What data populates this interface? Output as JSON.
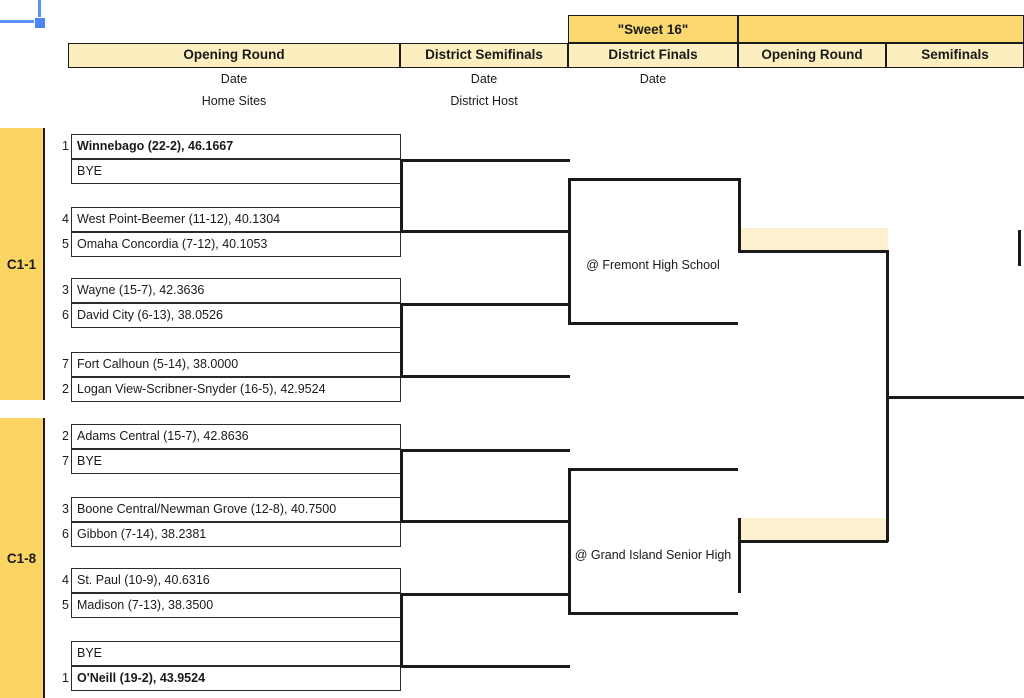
{
  "selection": {
    "name": "cell-selection-handle",
    "color": "#4a86f7"
  },
  "header": {
    "sweet16_label": "\"Sweet 16\"",
    "rounds": [
      {
        "label": "Opening Round",
        "date": "Date",
        "site": "Home Sites"
      },
      {
        "label": "District Semifinals",
        "date": "Date",
        "site": "District Host"
      },
      {
        "label": "District Finals",
        "date": "Date",
        "site": ""
      },
      {
        "label": "Opening Round",
        "date": "",
        "site": ""
      },
      {
        "label": "Semifinals",
        "date": "",
        "site": ""
      }
    ]
  },
  "colors": {
    "header_light_gold": "#fdeec0",
    "header_dark_gold": "#fbd970",
    "district_gold": "#fbd464",
    "slot_cream": "#fdf0cf",
    "line": "#1a1a1a"
  },
  "districts": [
    {
      "label": "C1-1",
      "venue": "@ Fremont High School",
      "matchups": [
        {
          "teams": [
            {
              "seed": "1",
              "name": "Winnebago (22-2), 46.1667",
              "bold": true
            },
            {
              "seed": "",
              "name": "BYE",
              "bold": false
            }
          ]
        },
        {
          "teams": [
            {
              "seed": "4",
              "name": "West Point-Beemer (11-12), 40.1304",
              "bold": false
            },
            {
              "seed": "5",
              "name": "Omaha Concordia (7-12), 40.1053",
              "bold": false
            }
          ]
        },
        {
          "teams": [
            {
              "seed": "3",
              "name": "Wayne (15-7), 42.3636",
              "bold": false
            },
            {
              "seed": "6",
              "name": "David City (6-13), 38.0526",
              "bold": false
            }
          ]
        },
        {
          "teams": [
            {
              "seed": "7",
              "name": "Fort Calhoun (5-14), 38.0000",
              "bold": false
            },
            {
              "seed": "2",
              "name": "Logan View-Scribner-Snyder (16-5), 42.9524",
              "bold": false
            }
          ]
        }
      ]
    },
    {
      "label": "C1-8",
      "venue": "@ Grand Island Senior High",
      "matchups": [
        {
          "teams": [
            {
              "seed": "2",
              "name": "Adams Central (15-7), 42.8636",
              "bold": false
            },
            {
              "seed": "7",
              "name": "BYE",
              "bold": false
            }
          ]
        },
        {
          "teams": [
            {
              "seed": "3",
              "name": "Boone Central/Newman Grove (12-8), 40.7500",
              "bold": false
            },
            {
              "seed": "6",
              "name": "Gibbon (7-14), 38.2381",
              "bold": false
            }
          ]
        },
        {
          "teams": [
            {
              "seed": "4",
              "name": "St. Paul (10-9), 40.6316",
              "bold": false
            },
            {
              "seed": "5",
              "name": "Madison (7-13), 38.3500",
              "bold": false
            }
          ]
        },
        {
          "teams": [
            {
              "seed": "",
              "name": "BYE",
              "bold": false
            },
            {
              "seed": "1",
              "name": "O'Neill (19-2), 43.9524",
              "bold": true
            }
          ]
        }
      ]
    }
  ]
}
